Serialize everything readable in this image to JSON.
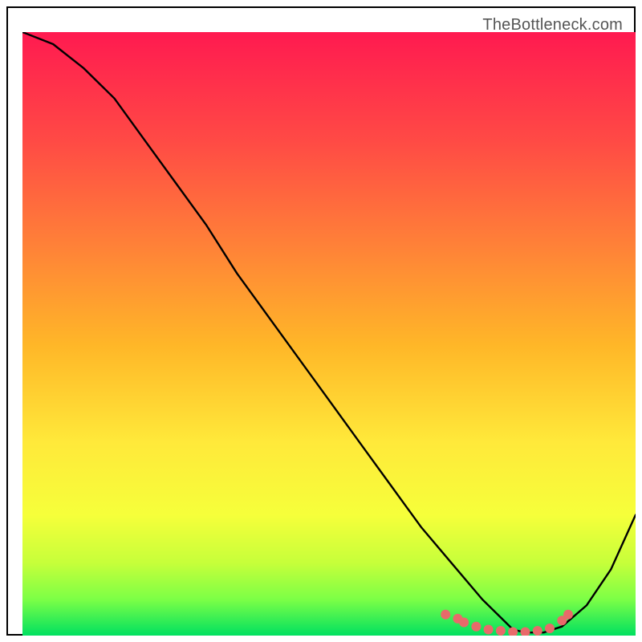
{
  "watermark": "TheBottleneck.com",
  "colors": {
    "curve": "#000000",
    "dot": "#e86a6a",
    "gradient_top": "#ff1a50",
    "gradient_mid_upper": "#ff6a3a",
    "gradient_mid": "#ffb728",
    "gradient_mid_lower": "#ffe93a",
    "gradient_lime": "#c6ff3a",
    "gradient_bottom": "#00e060"
  },
  "chart_data": {
    "type": "line",
    "title": "",
    "xlabel": "",
    "ylabel": "",
    "xlim": [
      0,
      100
    ],
    "ylim": [
      0,
      100
    ],
    "description": "Bottleneck percentage curve overlaid on a red-to-green vertical heat gradient. The curve descends from top-left, reaches a minimum near x≈80, then rises again. Salmon dots mark sample points near the trough.",
    "series": [
      {
        "name": "curve",
        "x": [
          0,
          5,
          10,
          15,
          20,
          25,
          30,
          35,
          40,
          45,
          50,
          55,
          60,
          65,
          70,
          75,
          78,
          80,
          82,
          85,
          88,
          92,
          96,
          100
        ],
        "y": [
          100,
          98,
          94,
          89,
          82,
          75,
          68,
          60,
          53,
          46,
          39,
          32,
          25,
          18,
          12,
          6,
          3,
          1,
          0.5,
          0.5,
          1.5,
          5,
          11,
          20
        ]
      }
    ],
    "dots": {
      "name": "trough-samples",
      "x": [
        69,
        71,
        72,
        74,
        76,
        78,
        80,
        82,
        84,
        86,
        88,
        89
      ],
      "y": [
        3.5,
        2.8,
        2.2,
        1.5,
        1.0,
        0.8,
        0.6,
        0.6,
        0.8,
        1.2,
        2.5,
        3.5
      ]
    }
  }
}
